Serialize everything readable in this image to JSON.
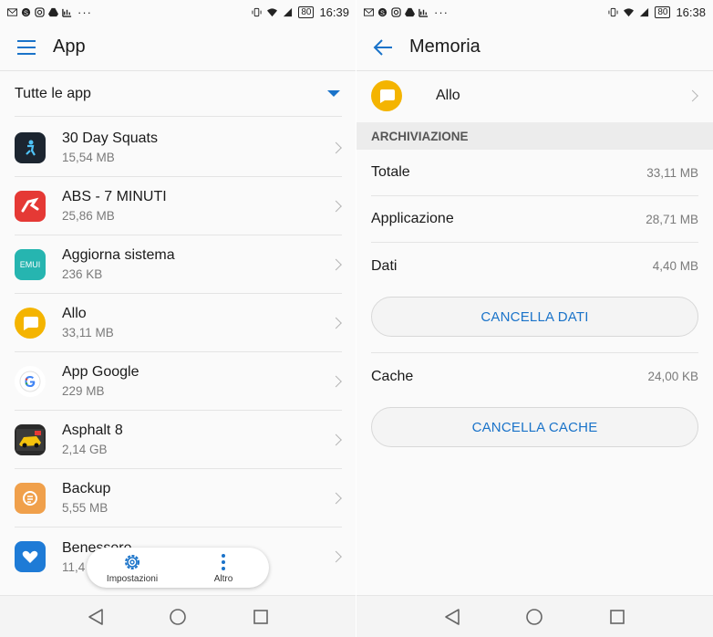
{
  "left": {
    "status": {
      "battery": "80",
      "time": "16:39"
    },
    "appbar": {
      "title": "App",
      "menu_icon": "hamburger-icon"
    },
    "filter": {
      "label": "Tutte le app"
    },
    "apps": [
      {
        "name": "30 Day Squats",
        "size": "15,54 MB",
        "icon": "squats-app-icon",
        "color": "#1c2530"
      },
      {
        "name": "ABS - 7 MINUTI",
        "size": "25,86 MB",
        "icon": "abs-app-icon",
        "color": "#e53935"
      },
      {
        "name": "Aggiorna sistema",
        "size": "236 KB",
        "icon": "emui-app-icon",
        "color": "#26b5b0",
        "badge": "EMUI"
      },
      {
        "name": "Allo",
        "size": "33,11 MB",
        "icon": "allo-app-icon",
        "color": "#f4b400"
      },
      {
        "name": "App Google",
        "size": "229 MB",
        "icon": "google-app-icon",
        "color": "#ffffff"
      },
      {
        "name": "Asphalt 8",
        "size": "2,14 GB",
        "icon": "asphalt-app-icon",
        "color": "#2a2a2a"
      },
      {
        "name": "Backup",
        "size": "5,55 MB",
        "icon": "backup-app-icon",
        "color": "#f0a04b"
      },
      {
        "name": "Benessere",
        "size": "11,4 MB",
        "icon": "wellness-app-icon",
        "color": "#1e7bd6"
      }
    ],
    "float_menu": {
      "settings_label": "Impostazioni",
      "more_label": "Altro"
    }
  },
  "right": {
    "status": {
      "battery": "80",
      "time": "16:38"
    },
    "appbar": {
      "title": "Memoria",
      "back_icon": "back-arrow-icon"
    },
    "app": {
      "name": "Allo"
    },
    "section": "ARCHIVIAZIONE",
    "rows": [
      {
        "label": "Totale",
        "value": "33,11 MB"
      },
      {
        "label": "Applicazione",
        "value": "28,71 MB"
      },
      {
        "label": "Dati",
        "value": "4,40 MB"
      }
    ],
    "clear_data_label": "CANCELLA DATI",
    "cache": {
      "label": "Cache",
      "value": "24,00 KB"
    },
    "clear_cache_label": "CANCELLA CACHE"
  },
  "colors": {
    "accent": "#1a73c9"
  }
}
